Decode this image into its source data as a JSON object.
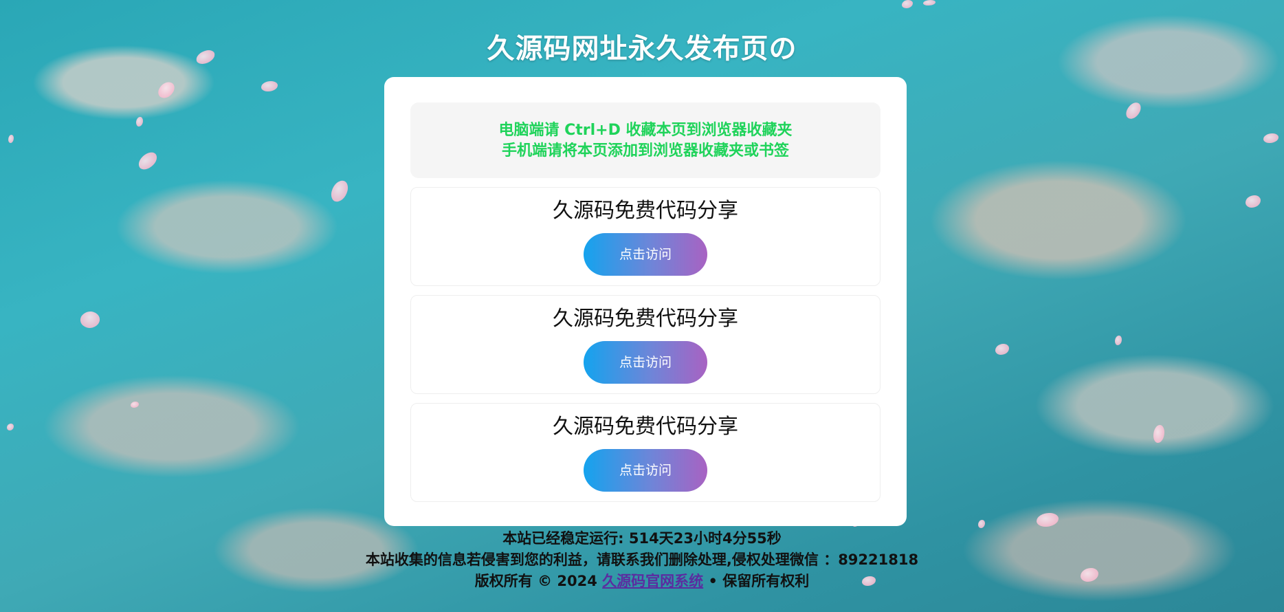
{
  "page": {
    "title": "久源码网址永久发布页の"
  },
  "notice": {
    "line1": "电脑端请 Ctrl+D 收藏本页到浏览器收藏夹",
    "line2": "手机端请将本页添加到浏览器收藏夹或书签"
  },
  "cards": [
    {
      "title": "久源码免费代码分享",
      "button": "点击访问"
    },
    {
      "title": "久源码免费代码分享",
      "button": "点击访问"
    },
    {
      "title": "久源码免费代码分享",
      "button": "点击访问"
    }
  ],
  "footer": {
    "uptime": "本站已经稳定运行: 514天23小时4分55秒",
    "disclaimer": "本站收集的信息若侵害到您的利益，请联系我们删除处理,侵权处理微信 ：89221818",
    "copyright_prefix": "版权所有 © 2024 ",
    "copyright_link": "久源码官网系统",
    "copyright_suffix": " • 保留所有权利"
  },
  "colors": {
    "notice_text": "#1fd35a",
    "button_start": "#14a3ee",
    "button_end": "#a862c2",
    "link": "#5b2ca0"
  }
}
